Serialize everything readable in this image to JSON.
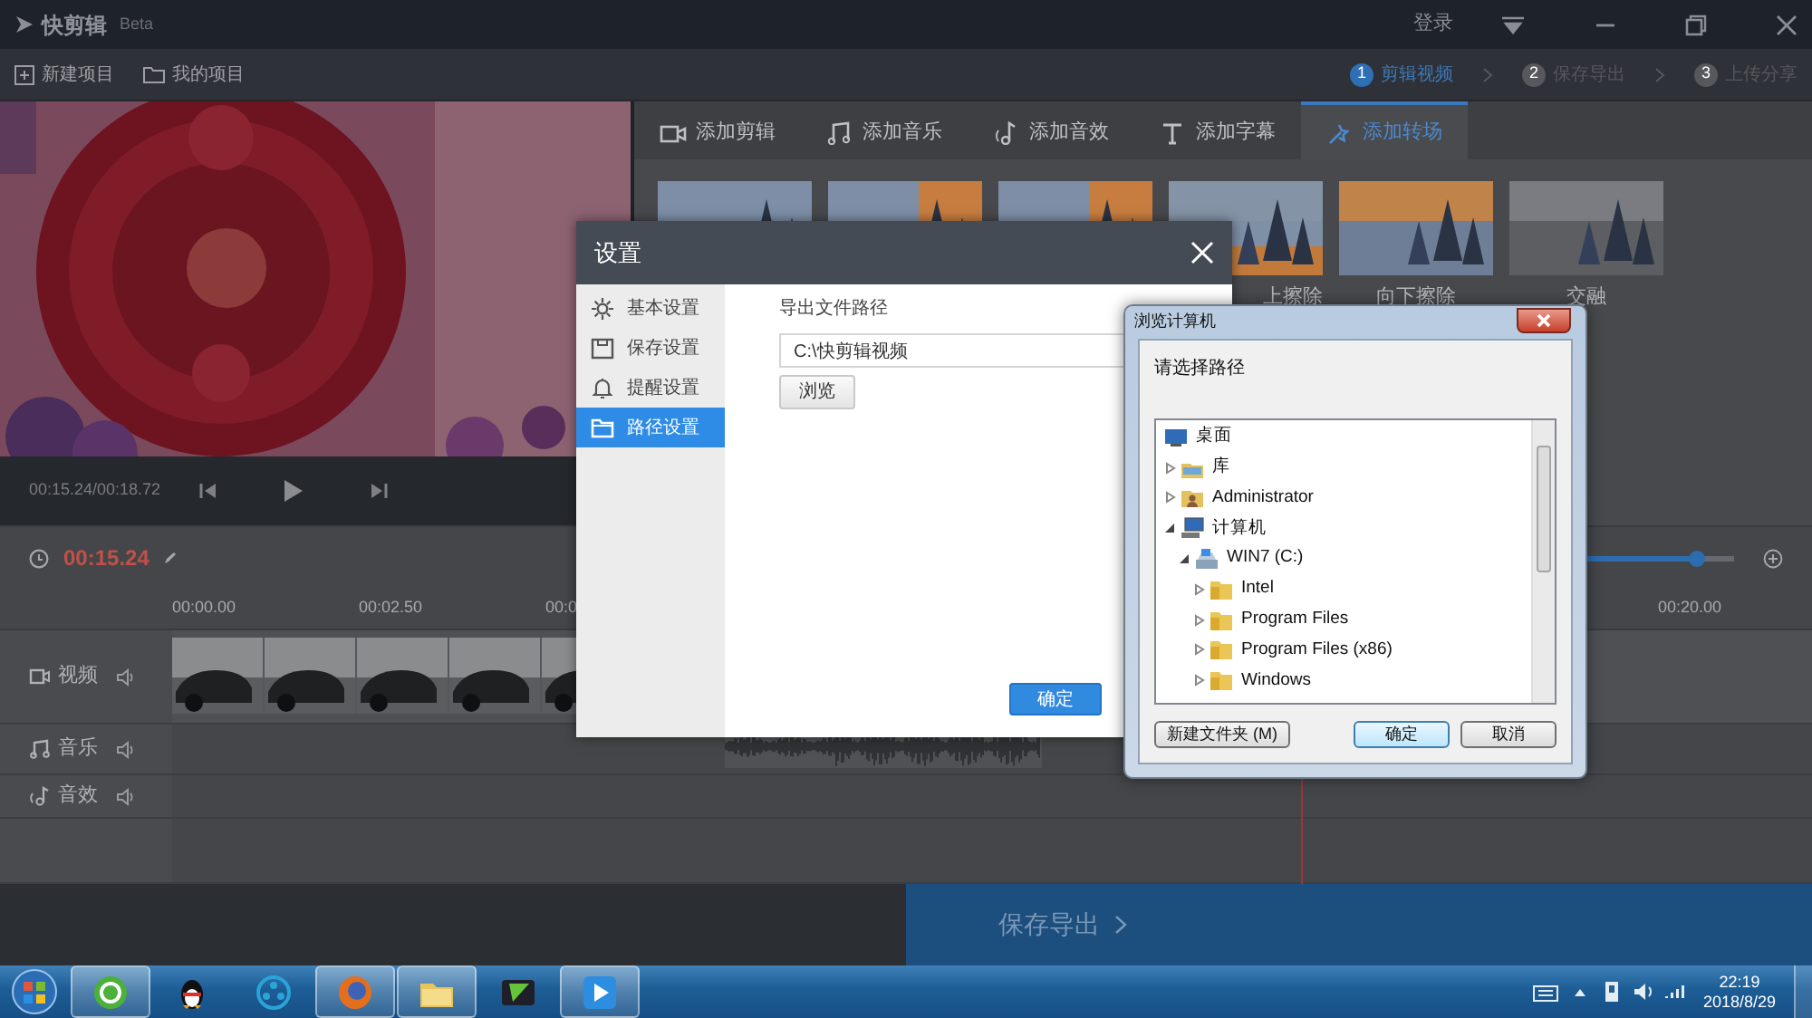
{
  "app": {
    "title": "快剪辑",
    "badge": "Beta",
    "login": "登录"
  },
  "toolbar": {
    "items": [
      {
        "label": "新建项目",
        "kind": "new"
      },
      {
        "label": "我的项目",
        "kind": "folder"
      }
    ],
    "steps": [
      {
        "number": "1",
        "label": "剪辑视频",
        "selected": true
      },
      {
        "number": "2",
        "label": "保存导出",
        "selected": false
      },
      {
        "number": "3",
        "label": "上传分享",
        "selected": false
      }
    ]
  },
  "preview": {
    "kind": "picture",
    "time": "00:15.24/00:18.72"
  },
  "tabs": [
    {
      "label": "添加剪辑",
      "kind": "video",
      "selected": false
    },
    {
      "label": "添加音乐",
      "kind": "music",
      "selected": false
    },
    {
      "label": "添加音效",
      "kind": "sound",
      "selected": false
    },
    {
      "label": "添加字幕",
      "kind": "text",
      "selected": false
    },
    {
      "label": "添加转场",
      "kind": "transition",
      "selected": true
    }
  ],
  "transitions": [
    {
      "kind": "picture"
    },
    {
      "kind": "picture"
    },
    {
      "kind": "picture"
    },
    {
      "kind": "picture",
      "label": "上擦除"
    },
    {
      "kind": "picture",
      "label": "向下擦除"
    },
    {
      "kind": "picture",
      "label": "交融"
    }
  ],
  "timeline": {
    "time": "00:15.24",
    "zoom": {
      "level": 0.76
    },
    "ruler": [
      "00:00.00",
      "00:02.50",
      "00:0",
      "00:20.00"
    ],
    "tracks": [
      {
        "label": "视频",
        "kind": "video"
      },
      {
        "label": "音乐",
        "kind": "music"
      },
      {
        "label": "音效",
        "kind": "sound"
      }
    ]
  },
  "export_button": "保存导出",
  "settings_dialog": {
    "title": "设置",
    "nav": [
      {
        "label": "基本设置",
        "kind": "gear",
        "selected": false
      },
      {
        "label": "保存设置",
        "kind": "save",
        "selected": false
      },
      {
        "label": "提醒设置",
        "kind": "bell",
        "selected": false
      },
      {
        "label": "路径设置",
        "kind": "folder",
        "selected": true
      }
    ],
    "field_label": "导出文件路径",
    "path": "C:\\快剪辑视频",
    "browse": "浏览",
    "ok": "确定"
  },
  "browse_dialog": {
    "title": "浏览计算机",
    "prompt": "请选择路径",
    "tree": [
      {
        "label": "桌面",
        "kind": "desktop",
        "children": [
          {
            "label": "库",
            "kind": "library",
            "expanded": false
          },
          {
            "label": "Administrator",
            "kind": "user",
            "expanded": false
          },
          {
            "label": "计算机",
            "kind": "computer",
            "expanded": true,
            "children": [
              {
                "label": "WIN7 (C:)",
                "kind": "drive",
                "expanded": true,
                "children": [
                  {
                    "label": "Intel",
                    "kind": "folder",
                    "expanded": false
                  },
                  {
                    "label": "Program Files",
                    "kind": "folder",
                    "expanded": false
                  },
                  {
                    "label": "Program Files (x86)",
                    "kind": "folder",
                    "expanded": false
                  },
                  {
                    "label": "Windows",
                    "kind": "folder",
                    "expanded": false
                  }
                ]
              }
            ]
          }
        ]
      }
    ],
    "buttons": [
      {
        "label": "新建文件夹 (M)",
        "default": false
      },
      {
        "label": "确定",
        "default": true
      },
      {
        "label": "取消",
        "default": false
      }
    ]
  },
  "taskbar": {
    "apps": [
      {
        "kind": "browser360",
        "running": true
      },
      {
        "kind": "qq",
        "running": false
      },
      {
        "kind": "media",
        "running": false
      },
      {
        "kind": "firefox",
        "running": true
      },
      {
        "kind": "explorer",
        "running": true
      },
      {
        "kind": "greenapp",
        "running": false
      },
      {
        "kind": "kuaijianji",
        "running": true
      }
    ],
    "time": "22:19",
    "date": "2018/8/29"
  }
}
